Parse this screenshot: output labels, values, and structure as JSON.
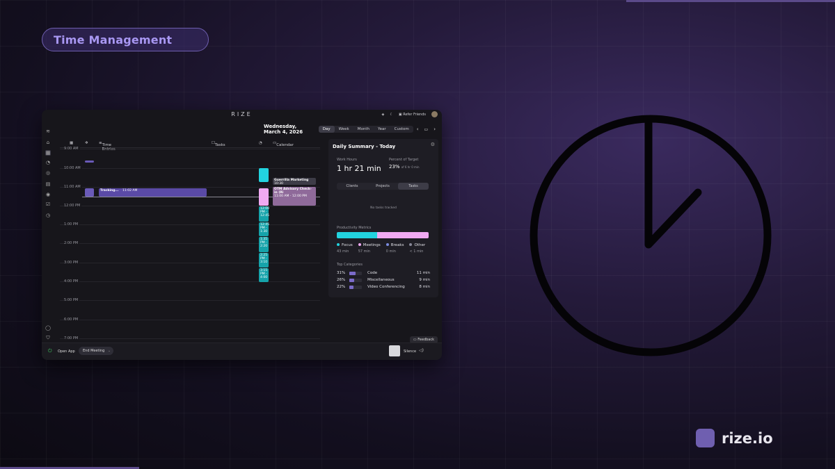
{
  "hero": {
    "pill_label": "Time Management"
  },
  "brand": {
    "name": "rize.io",
    "color": "#6f5fb0"
  },
  "app": {
    "title": "RIZE",
    "titlebar": {
      "refer_label": "Refer Friends"
    },
    "toolbar": {
      "date": "Wednesday, March 4, 2026",
      "views": [
        "Day",
        "Week",
        "Month",
        "Year",
        "Custom"
      ],
      "active_view": "Day"
    },
    "columns": {
      "time_entries": "Time Entries",
      "tasks": "Tasks",
      "calendar": "Calendar"
    },
    "hours": [
      "9:00 AM",
      "10:00 AM",
      "11:00 AM",
      "12:00 PM",
      "1:00 PM",
      "2:00 PM",
      "3:00 PM",
      "4:00 PM",
      "5:00 PM",
      "6:00 PM",
      "7:00 PM"
    ],
    "entries": {
      "tracking_label": "Tracking...",
      "tracking_time": "11:02 AM"
    },
    "tasks_col": {
      "b1": "12:00 PM - 12:45",
      "b2": "12:45 PM - 1:30",
      "b3": "1:35 PM - 2:20",
      "b4": "2:25 PM - 3:10",
      "b5": "3:15 PM - 4:00"
    },
    "calendar_events": {
      "e1_title": "Guerrilla Marketing",
      "e1_time": "10:30",
      "e2_title": "OTM Advisory Check-in (Ri",
      "e2_time": "11:00 AM - 12:00 PM"
    },
    "summary": {
      "title": "Daily Summary - Today",
      "work_hours_label": "Work Hours",
      "work_hours_value": "1 hr 21 min",
      "pct_label": "Percent of Target",
      "pct_value": "23%",
      "pct_sub": "of 6 hr 0 min",
      "tabs": [
        "Clients",
        "Projects",
        "Tasks"
      ],
      "active_tab": "Tasks",
      "empty_text": "No tasks tracked",
      "metrics_label": "Productivity Metrics",
      "metrics": [
        {
          "name": "Focus",
          "time": "43 min",
          "color": "#22d3df",
          "fraction": 0.44
        },
        {
          "name": "Meetings",
          "time": "57 min",
          "color": "#f0a9f2",
          "fraction": 0.56
        },
        {
          "name": "Breaks",
          "time": "0 min",
          "color": "#7b8ce0",
          "fraction": 0
        },
        {
          "name": "Other",
          "time": "< 1 min",
          "color": "#888899",
          "fraction": 0
        }
      ],
      "categories_label": "Top Categories",
      "categories": [
        {
          "pct": "31%",
          "name": "Code",
          "time": "11 min",
          "fraction": 0.31
        },
        {
          "pct": "26%",
          "name": "Miscellaneous",
          "time": "9 min",
          "fraction": 0.26
        },
        {
          "pct": "22%",
          "name": "Video Conferencing",
          "time": "8 min",
          "fraction": 0.22
        }
      ]
    },
    "feedback_label": "Feedback",
    "bottom": {
      "open_app": "Open App",
      "end_meeting": "End Meeting",
      "silence": "Silence"
    }
  }
}
